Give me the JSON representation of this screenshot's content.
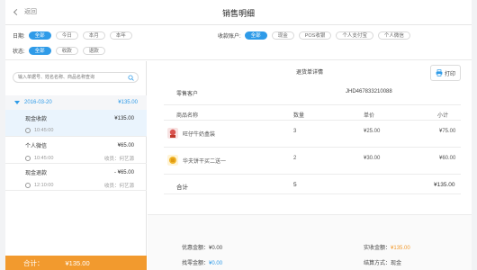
{
  "header": {
    "back_label": "返回",
    "title": "销售明细"
  },
  "filters": {
    "date_label": "日期:",
    "date_options": [
      "全部",
      "今日",
      "本月",
      "本年"
    ],
    "status_label": "状态:",
    "status_options": [
      "全部",
      "收款",
      "退款"
    ],
    "account_label": "收款账户:",
    "account_options": [
      "全部",
      "现金",
      "POS收银",
      "个人支付宝",
      "个人微信"
    ]
  },
  "search": {
    "placeholder": "输入单据号、姓名名称、商品名称查询"
  },
  "day_group": {
    "date": "2016-03-20",
    "amount": "¥135.00"
  },
  "records": [
    {
      "type": "现金收款",
      "amount": "¥135.00",
      "time": "10:45:00",
      "cashier": "",
      "selected": true
    },
    {
      "type": "个人微信",
      "amount": "¥65.00",
      "time": "10:45:00",
      "cashier": "收员：何艺源",
      "selected": false
    },
    {
      "type": "现金退款",
      "amount": "- ¥65.00",
      "time": "12:10:00",
      "cashier": "收员：何艺源",
      "selected": false
    }
  ],
  "footer": {
    "label": "合计：",
    "amount": "¥135.00"
  },
  "detail": {
    "title": "退货单详情",
    "print_label": "打印",
    "customer": "零售客户",
    "order_no": "JHD467833210088",
    "columns": {
      "name": "商品名称",
      "qty": "数量",
      "price": "单价",
      "subtotal": "小计"
    },
    "items": [
      {
        "name": "旺仔牛奶盒装",
        "qty": "3",
        "price": "¥25.00",
        "subtotal": "¥75.00"
      },
      {
        "name": "华夫饼干买二送一",
        "qty": "2",
        "price": "¥30.00",
        "subtotal": "¥60.00"
      }
    ],
    "total": {
      "label": "合计",
      "qty": "5",
      "amount": "¥135.00"
    },
    "summary": {
      "discount_label": "优惠金额：",
      "discount": "¥0.00",
      "change_label": "找零金额：",
      "change": "¥0.00",
      "paid_label": "实收金额：",
      "paid": "¥135.00",
      "method_label": "结算方式：",
      "method": "现金"
    }
  },
  "colors": {
    "accent": "#2f9be8",
    "orange": "#f29a2e"
  }
}
